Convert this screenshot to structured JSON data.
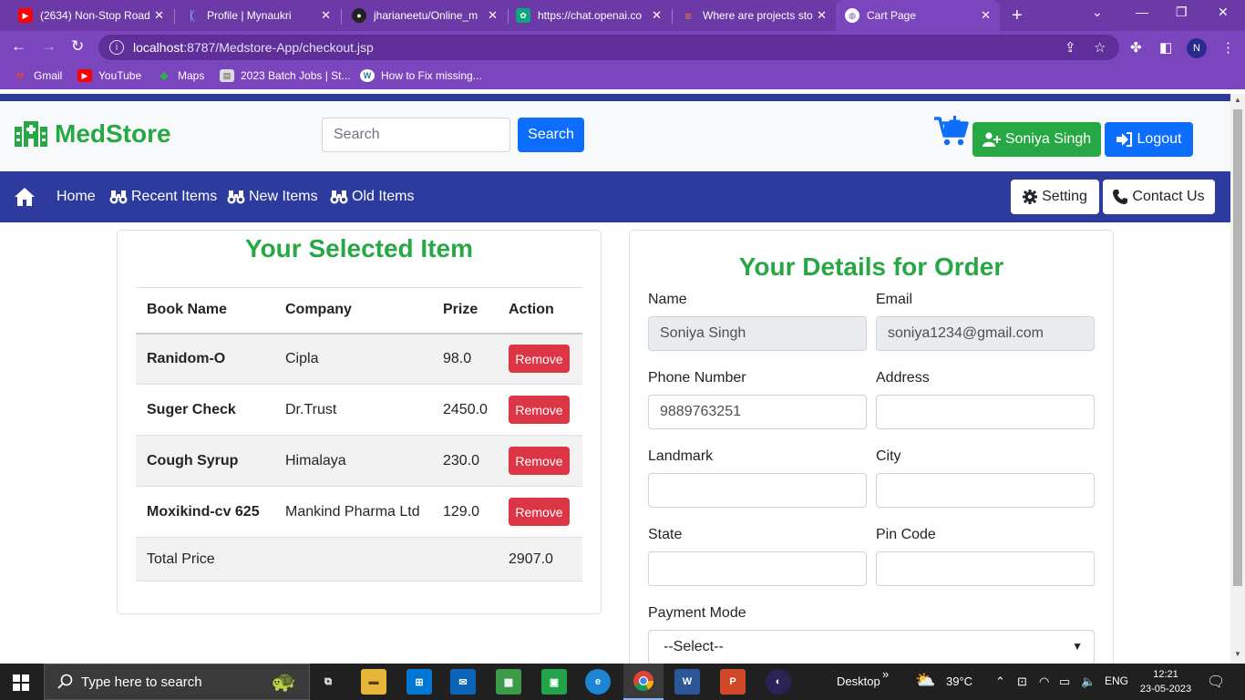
{
  "browser": {
    "tabs": [
      {
        "title": "(2634) Non-Stop Road",
        "favicon": "youtube-icon",
        "color": "#ff0000"
      },
      {
        "title": "Profile | Mynaukri",
        "favicon": "naukri-icon",
        "color": "#4a90e2"
      },
      {
        "title": "jharianeetu/Online_m",
        "favicon": "github-icon",
        "color": "#222222"
      },
      {
        "title": "https://chat.openai.co",
        "favicon": "openai-icon",
        "color": "#10a37f"
      },
      {
        "title": "Where are projects sto",
        "favicon": "stackoverflow-icon",
        "color": "#f48024"
      },
      {
        "title": "Cart Page",
        "favicon": "globe-icon",
        "color": "#ffffff"
      }
    ],
    "url_host": "localhost",
    "url_rest": ":8787/Medstore-App/checkout.jsp",
    "profile_initial": "N",
    "bookmarks": [
      {
        "label": "Gmail",
        "icon": "gmail-icon"
      },
      {
        "label": "YouTube",
        "icon": "youtube-icon"
      },
      {
        "label": "Maps",
        "icon": "maps-icon"
      },
      {
        "label": "2023 Batch Jobs | St...",
        "icon": "doc-icon"
      },
      {
        "label": "How to Fix missing...",
        "icon": "wordpress-icon"
      }
    ]
  },
  "site": {
    "brand": "MedStore",
    "search_placeholder": "Search",
    "search_button": "Search",
    "user_button": "Soniya Singh",
    "logout_button": "Logout",
    "nav": {
      "home": "Home",
      "recent": "Recent Items",
      "new": "New Items",
      "old": "Old Items",
      "setting": "Setting",
      "contact": "Contact Us"
    },
    "colors": {
      "primary": "#0d6efd",
      "success": "#28a745",
      "danger": "#dc3545",
      "nav": "#2e3b9e"
    }
  },
  "cart": {
    "title": "Your Selected Item",
    "headers": [
      "Book Name",
      "Company",
      "Prize",
      "Action"
    ],
    "rows": [
      {
        "name": "Ranidom-O",
        "company": "Cipla",
        "price": "98.0",
        "action": "Remove"
      },
      {
        "name": "Suger Check",
        "company": "Dr.Trust",
        "price": "2450.0",
        "action": "Remove"
      },
      {
        "name": "Cough Syrup",
        "company": "Himalaya",
        "price": "230.0",
        "action": "Remove"
      },
      {
        "name": "Moxikind-cv 625",
        "company": "Mankind Pharma Ltd",
        "price": "129.0",
        "action": "Remove"
      }
    ],
    "total_label": "Total Price",
    "total_value": "2907.0"
  },
  "order": {
    "title": "Your Details for Order",
    "name_label": "Name",
    "name_value": "Soniya Singh",
    "email_label": "Email",
    "email_value": "soniya1234@gmail.com",
    "phone_label": "Phone Number",
    "phone_value": "9889763251",
    "address_label": "Address",
    "address_value": "",
    "landmark_label": "Landmark",
    "landmark_value": "",
    "city_label": "City",
    "city_value": "",
    "state_label": "State",
    "state_value": "",
    "pincode_label": "Pin Code",
    "pincode_value": "",
    "payment_label": "Payment Mode",
    "payment_selected": "--Select--"
  },
  "taskbar": {
    "search_placeholder": "Type here to search",
    "desktop_label": "Desktop",
    "weather": "39°C",
    "language": "ENG",
    "time": "12:21",
    "date": "23-05-2023"
  }
}
